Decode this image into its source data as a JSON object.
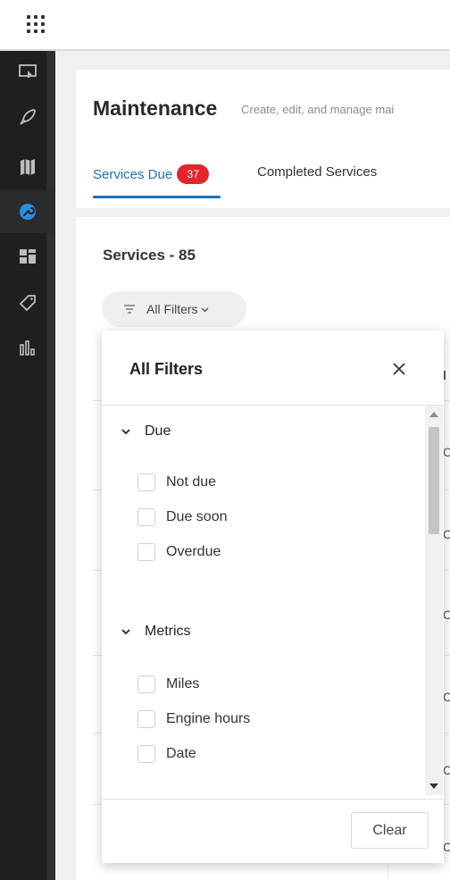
{
  "app": {
    "launcher_icon": "waffle-grid-icon"
  },
  "sidebar": {
    "items": [
      {
        "icon": "monitor-icon",
        "active": false
      },
      {
        "icon": "rocket-icon",
        "active": false
      },
      {
        "icon": "map-icon",
        "active": false
      },
      {
        "icon": "wrench-icon",
        "active": true
      },
      {
        "icon": "dashboard-icon",
        "active": false
      },
      {
        "icon": "tag-icon",
        "active": false
      },
      {
        "icon": "reports-icon",
        "active": false
      }
    ]
  },
  "header": {
    "title": "Maintenance",
    "subtitle": "Create, edit, and manage mai",
    "tabs": [
      {
        "label": "Services Due",
        "badge": "37",
        "active": true
      },
      {
        "label": "Completed Services",
        "active": false
      }
    ]
  },
  "main": {
    "services_count": "Services - 85",
    "filter_button_label": "All Filters",
    "table_peek": [
      "C",
      "C",
      "C",
      "C",
      "C",
      "C"
    ],
    "header_peek": "l"
  },
  "filters_panel": {
    "title": "All Filters",
    "sections": [
      {
        "label": "Due",
        "options": [
          "Not due",
          "Due soon",
          "Overdue"
        ]
      },
      {
        "label": "Metrics",
        "options": [
          "Miles",
          "Engine hours",
          "Date"
        ]
      }
    ],
    "clear_label": "Clear"
  },
  "colors": {
    "accent": "#1f6fb5",
    "badge": "#e2262b",
    "sidebar_bg": "#1f1f1f",
    "active_icon": "#2d8fe0"
  }
}
